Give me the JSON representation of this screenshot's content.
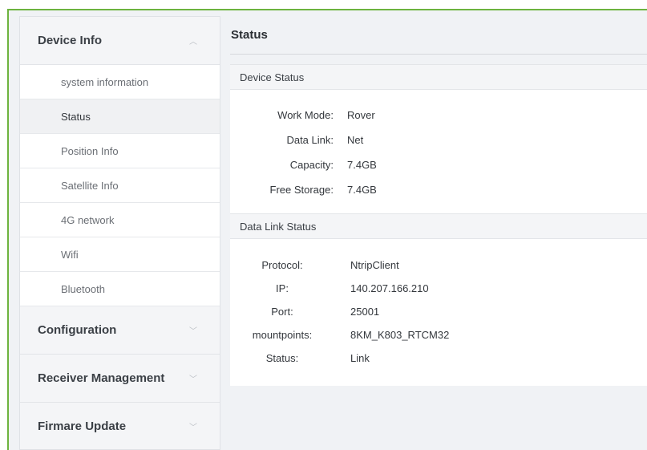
{
  "sidebar": {
    "groups": [
      {
        "label": "Device Info",
        "expanded": true,
        "items": [
          {
            "label": "system information"
          },
          {
            "label": "Status",
            "active": true
          },
          {
            "label": "Position Info"
          },
          {
            "label": "Satellite Info"
          },
          {
            "label": "4G network"
          },
          {
            "label": "Wifi"
          },
          {
            "label": "Bluetooth"
          }
        ]
      },
      {
        "label": "Configuration",
        "expanded": false
      },
      {
        "label": "Receiver Management",
        "expanded": false
      },
      {
        "label": "Firmare Update",
        "expanded": false
      }
    ],
    "chevron_up": "︿",
    "chevron_down": "﹀"
  },
  "main": {
    "title": "Status",
    "device_status": {
      "heading": "Device Status",
      "rows": [
        {
          "label": "Work Mode:",
          "value": "Rover"
        },
        {
          "label": "Data Link:",
          "value": "Net"
        },
        {
          "label": "Capacity:",
          "value": "7.4GB"
        },
        {
          "label": "Free Storage:",
          "value": "7.4GB"
        }
      ]
    },
    "data_link_status": {
      "heading": "Data Link Status",
      "rows": [
        {
          "label": "Protocol:",
          "value": "NtripClient"
        },
        {
          "label": "IP:",
          "value": "140.207.166.210"
        },
        {
          "label": "Port:",
          "value": "25001"
        },
        {
          "label": "mountpoints:",
          "value": "8KM_K803_RTCM32"
        },
        {
          "label": "Status:",
          "value": "Link"
        }
      ]
    }
  },
  "colors": {
    "frame_accent": "#6db33f",
    "sidebar_bg": "#f4f5f7",
    "active_item_bg": "#f0f1f3"
  }
}
